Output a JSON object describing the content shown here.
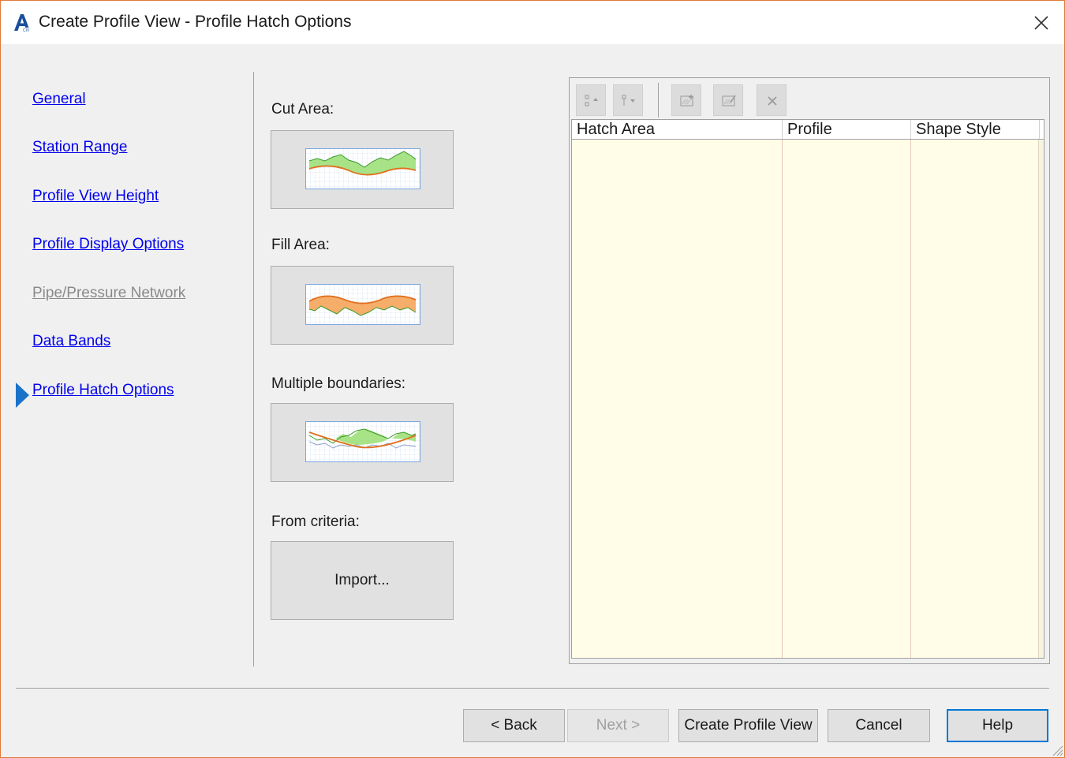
{
  "window": {
    "title": "Create Profile View - Profile Hatch Options",
    "icon": "autocad-civil-logo-icon",
    "close_icon": "close-icon"
  },
  "nav": {
    "items": [
      {
        "label": "General",
        "state": "link"
      },
      {
        "label": "Station Range",
        "state": "link"
      },
      {
        "label": "Profile View Height",
        "state": "link"
      },
      {
        "label": "Profile Display Options",
        "state": "link"
      },
      {
        "label": "Pipe/Pressure Network",
        "state": "disabled"
      },
      {
        "label": "Data Bands",
        "state": "link"
      },
      {
        "label": "Profile Hatch Options",
        "state": "current"
      }
    ],
    "current_indicator_color": "#1a73c8"
  },
  "hatch_options": {
    "cut_area_label": "Cut Area:",
    "fill_area_label": "Fill Area:",
    "multiple_boundaries_label": "Multiple boundaries:",
    "from_criteria_label": "From criteria:",
    "import_button": "Import..."
  },
  "grid": {
    "toolbar_icons": [
      "move-up-icon",
      "move-down-icon",
      "add-hatch-icon",
      "edit-hatch-icon",
      "delete-icon"
    ],
    "columns": [
      "Hatch Area",
      "Profile",
      "Shape Style"
    ],
    "rows": [],
    "row_background": "#fffde8"
  },
  "footer": {
    "back": "< Back",
    "next": "Next >",
    "create": "Create Profile View",
    "cancel": "Cancel",
    "help": "Help"
  },
  "colors": {
    "cut_fill": "#9fe07a",
    "fill_fill": "#f5a55a",
    "profile_line": "#e0701e",
    "ground_line": "#3a9a2a",
    "link": "#0000ee"
  }
}
